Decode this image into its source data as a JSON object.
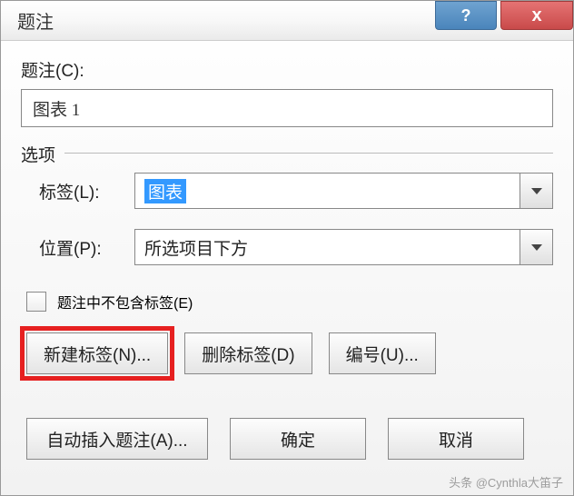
{
  "titlebar": {
    "title": "题注",
    "help": "?",
    "close": "x"
  },
  "caption": {
    "label": "题注(C):",
    "value": "图表 1"
  },
  "options": {
    "legend": "选项",
    "label_label": "标签(L):",
    "label_value": "图表",
    "position_label": "位置(P):",
    "position_value": "所选项目下方"
  },
  "exclude": {
    "label": "题注中不包含标签(E)"
  },
  "buttons": {
    "new_label": "新建标签(N)...",
    "delete_label": "删除标签(D)",
    "numbering": "编号(U)...",
    "auto_caption": "自动插入题注(A)...",
    "ok": "确定",
    "cancel": "取消"
  },
  "watermark": "头条 @Cynthla大笛子"
}
